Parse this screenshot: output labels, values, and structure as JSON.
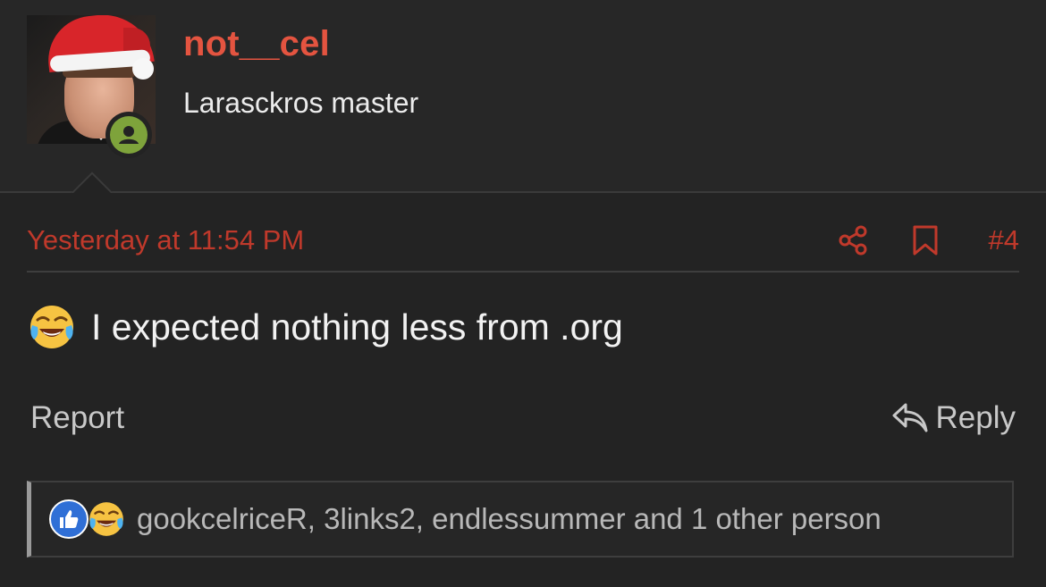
{
  "user": {
    "username": "not__cel",
    "title": "Larasckros master",
    "online": true
  },
  "post": {
    "timestamp": "Yesterday at 11:54 PM",
    "number": "#4",
    "message": "I expected nothing less from .org",
    "emoji": "face-with-tears-of-joy"
  },
  "actions": {
    "report_label": "Report",
    "reply_label": "Reply"
  },
  "reactions": {
    "icons": [
      "like-icon",
      "tears-of-joy-icon"
    ],
    "summary": "gookcelriceR, 3links2, endlessummer and 1 other person"
  },
  "colors": {
    "accent": "#e45440",
    "meta": "#c0392b",
    "background": "#232323",
    "online": "#7ea33b",
    "like": "#2f6fd6"
  }
}
